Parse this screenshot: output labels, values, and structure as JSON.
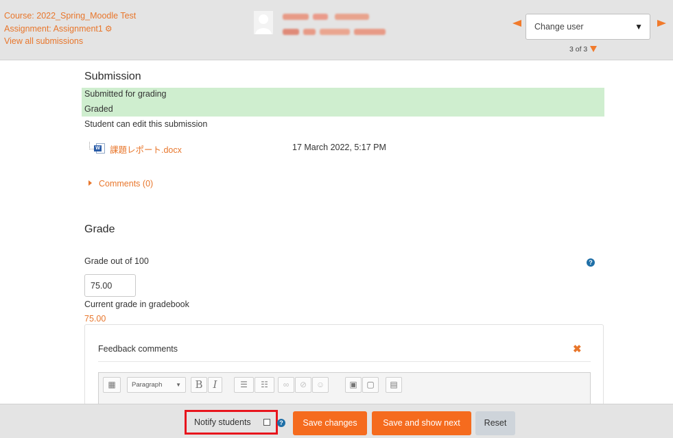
{
  "header": {
    "course_link": "Course: 2022_Spring_Moodle Test",
    "assignment_link": "Assignment: Assignment1",
    "view_all_link": "View all submissions",
    "change_user_label": "Change user",
    "user_counter": "3 of 3"
  },
  "submission": {
    "title": "Submission",
    "status_submitted": "Submitted for grading",
    "status_graded": "Graded",
    "edit_note": "Student can edit this submission",
    "file_name": "課題レポート.docx",
    "file_date": "17 March 2022, 5:17 PM",
    "comments_link": "Comments (0)"
  },
  "grade": {
    "title": "Grade",
    "grade_label": "Grade out of 100",
    "grade_value": "75.00",
    "gradebook_label": "Current grade in gradebook",
    "gradebook_value": "75.00"
  },
  "feedback": {
    "title": "Feedback comments",
    "paragraph_format": "Paragraph"
  },
  "footer": {
    "notify_label": "Notify students",
    "save_changes": "Save changes",
    "save_and_next": "Save and show next",
    "reset": "Reset"
  },
  "colors": {
    "accent": "#f56b1e",
    "link": "#e8762b",
    "status_band": "#cfeecf",
    "highlight_box": "#e8141c"
  }
}
